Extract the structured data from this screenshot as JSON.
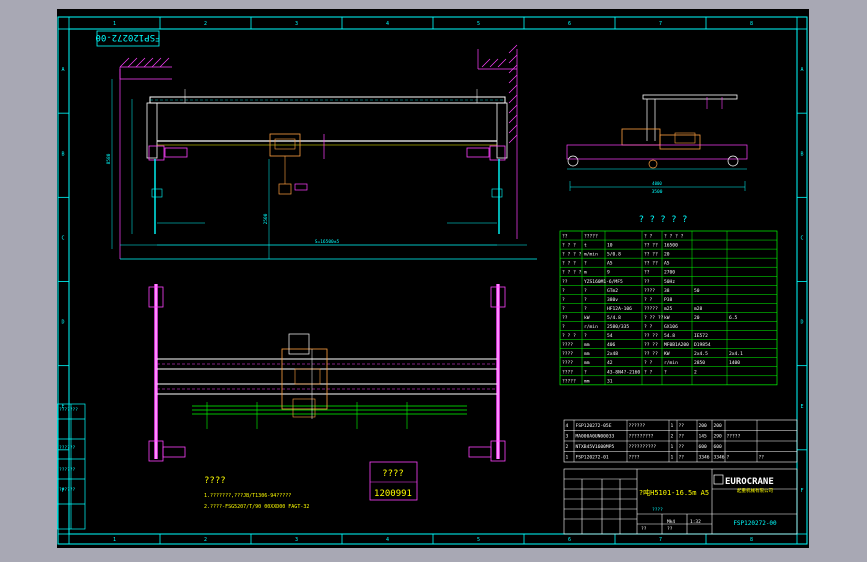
{
  "drawing": {
    "number_rotated": "FSP120272-00",
    "title_block": {
      "product": "?吨H5101-16.5m A5",
      "drawing_no": "FSP120272-00",
      "company": "EUROCRANE",
      "company_cn": "起重机械有限公司",
      "mark_unknown": "????",
      "scale_label": "Mk4",
      "scale_value": "1:32",
      "sheets": "??",
      "sheet_total": "??"
    },
    "top_grid_numbers": [
      "1",
      "2",
      "3",
      "4",
      "5",
      "6",
      "7",
      "8"
    ],
    "bottom_grid_numbers": [
      "1",
      "2",
      "3",
      "4",
      "5",
      "6",
      "7",
      "8"
    ],
    "left_letters": [
      "A",
      "B",
      "C",
      "D",
      "E",
      "F"
    ],
    "right_letters": [
      "A",
      "B",
      "C",
      "D",
      "E",
      "F"
    ],
    "notes": {
      "heading": "????",
      "line1": "1.???????,???JB/T1306-94?????",
      "line2": "2.????-FSG5207/T/90 00XXD00 FAGT-32"
    },
    "stamp": {
      "label": "????",
      "value": "1200991"
    },
    "dims": {
      "span": "S=16500±5",
      "height": "8580",
      "wheel_base": "3500",
      "side_gauge": "4000",
      "hook_h": "2500"
    },
    "tech_table": {
      "title": "? ? ? ? ?",
      "rows": [
        [
          "??",
          "?????",
          "",
          "? ?",
          "? ? ? ?"
        ],
        [
          "? ? ?",
          "t",
          "10",
          "?? ??",
          "16500"
        ],
        [
          "? ? ? ?",
          "m/min",
          "5/0.8",
          "?? ??",
          "20"
        ],
        [
          "? ? ?",
          "?",
          "A5",
          "?? ??",
          "A5"
        ],
        [
          "? ? ? ?",
          "m",
          "9",
          "??",
          "2700"
        ],
        [
          "??",
          "YZS160M1-6/MF5",
          "",
          "??",
          "50Hz"
        ],
        [
          "?",
          "?",
          "GTm2",
          "????",
          "38",
          "50"
        ],
        [
          "?",
          "?",
          "380v",
          "? ?",
          "P38"
        ],
        [
          "?",
          "?",
          "HF12A-106",
          "?????",
          "m25",
          "m28"
        ],
        [
          "??",
          "kW",
          "5/4.8",
          "? ?? ??",
          "kW",
          "20",
          "6.5"
        ],
        [
          "?",
          "r/min",
          "2580/335",
          "? ?",
          "GX106"
        ],
        [
          "? ? ?",
          "?",
          "54",
          "?? ??",
          "54.8",
          "IE572"
        ],
        [
          "????",
          "mm",
          "406",
          "?? ??",
          "MF0B1A200",
          "D19854"
        ],
        [
          "????",
          "mm",
          "2x48",
          "?? ??",
          "KW",
          "2x4.5",
          "2x4.1"
        ],
        [
          "????",
          "mm",
          "42",
          "? ?",
          "r/min",
          "2850",
          "1400"
        ],
        [
          "????",
          "?",
          "43-8N4?-2160",
          "? ?",
          "?",
          "2"
        ],
        [
          "?????",
          "mm",
          "31",
          "",
          "",
          ""
        ]
      ]
    },
    "bom": [
      [
        "4",
        "FSP120272-05E",
        "??????",
        "1",
        "??",
        "200",
        "200"
      ],
      [
        "3",
        "MA000A0UN00033",
        "?????????",
        "2",
        "??",
        "145",
        "290",
        "?????"
      ],
      [
        "2",
        "NTXB45V1600MP5",
        "??????????",
        "1",
        "??",
        "600",
        "600"
      ],
      [
        "1",
        "FSP120272-01",
        "????",
        "1",
        "??",
        "3346",
        "3346",
        "?",
        "??"
      ]
    ]
  }
}
